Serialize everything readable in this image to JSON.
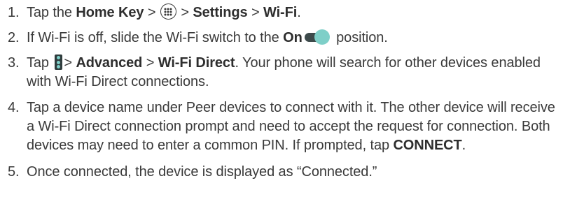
{
  "steps": [
    {
      "number": "1.",
      "parts": {
        "a": "Tap the ",
        "b": "Home Key",
        "c": " > ",
        "d": " > ",
        "e": "Settings",
        "f": " > ",
        "g": "Wi-Fi",
        "h": "."
      }
    },
    {
      "number": "2.",
      "parts": {
        "a": "If Wi-Fi is off, slide the Wi-Fi switch to the ",
        "b": "On",
        "c": " position."
      }
    },
    {
      "number": "3.",
      "parts": {
        "a": "Tap ",
        "b": "> ",
        "c": "Advanced",
        "d": " > ",
        "e": "Wi-Fi Direct",
        "f": ". Your phone will search for other devices enabled with Wi-Fi Direct connections."
      }
    },
    {
      "number": "4.",
      "parts": {
        "a": "Tap a device name under Peer devices to connect with it. The other device will receive a Wi-Fi Direct connection prompt and need to accept the request for connection. Both devices may need to enter a common PIN. If prompted, tap ",
        "b": "CONNECT",
        "c": "."
      }
    },
    {
      "number": "5.",
      "parts": {
        "a": "Once connected, the device is displayed as “Connected.”"
      }
    }
  ],
  "icons": {
    "apps": "apps-icon",
    "toggle": "toggle-switch-on-icon",
    "more": "more-options-icon"
  },
  "colors": {
    "text": "#3a3a3a",
    "toggle_track": "#3d4a4b",
    "toggle_knob": "#7ecfc8",
    "more_icon_bg": "#2f3c3d"
  }
}
